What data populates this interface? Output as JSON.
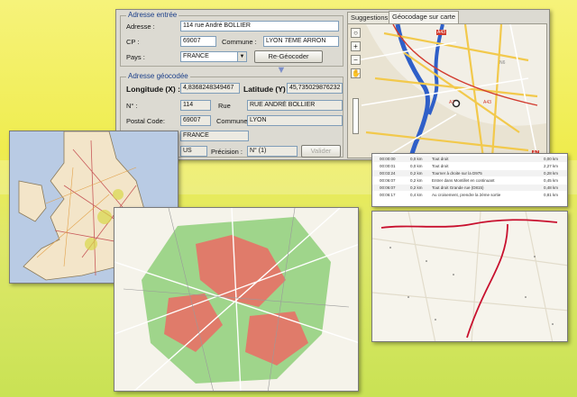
{
  "window": {
    "group_input": {
      "title": "Adresse entrée",
      "address_label": "Adresse :",
      "address_value": "114 rue André BOLLIER",
      "cp_label": "CP :",
      "cp_value": "69007",
      "commune_label": "Commune :",
      "commune_value": "LYON 7EME ARRON",
      "country_label": "Pays :",
      "country_value": "FRANCE",
      "regeocode_button": "Re-Géocoder"
    },
    "group_result": {
      "title": "Adresse géocodée",
      "longitude_label": "Longitude (X) :",
      "longitude_value": "4,8368248349467",
      "latitude_label": "Latitude (Y) :",
      "latitude_value": "45,735029876232",
      "number_label": "N° :",
      "number_value": "114",
      "street_type_value": "Rue",
      "street_value": "RUE ANDRÉ BOLLIER",
      "postal_label": "Postal Code:",
      "postal_value": "69007",
      "commune_label": "Commune :",
      "commune_value": "LYON",
      "country_value": "FRANCE",
      "status_value": "US",
      "precision_label": "Précision :",
      "precision_value": "N° (1)",
      "validate_button": "Valider"
    },
    "tabs": [
      "Suggestions",
      "Géocodage sur carte"
    ],
    "map": {
      "label_a": "A43",
      "label_b": "A7",
      "label_c": "A43",
      "label_d": "A7",
      "label_e": "N6"
    }
  },
  "itinerary": {
    "rows": [
      {
        "time": "00:00:00",
        "dist": "0,0 km",
        "text": "Tout droit",
        "total": "0,00 km"
      },
      {
        "time": "00:00:01",
        "dist": "0,0 km",
        "text": "Tout droit",
        "total": "2,27 km"
      },
      {
        "time": "00:03:24",
        "dist": "0,2 km",
        "text": "Tourner à droite sur la D975",
        "total": "0,28 km"
      },
      {
        "time": "00:06:07",
        "dist": "0,2 km",
        "text": "Entrer dans Montillet en continuant",
        "total": "0,45 km"
      },
      {
        "time": "00:06:07",
        "dist": "0,2 km",
        "text": "Tout droit Grande rue (D815)",
        "total": "0,48 km"
      },
      {
        "time": "00:06:17",
        "dist": "0,4 km",
        "text": "Au croisement, prendre la 2ème sortie",
        "total": "0,81 km"
      }
    ]
  },
  "colors": {
    "background": "#efec4e",
    "window_bg": "#dcdad2",
    "group_title": "#1b3f8a",
    "route": "#c8102e",
    "zone_red": "#e07b6a",
    "zone_green": "#8fcf7a"
  }
}
